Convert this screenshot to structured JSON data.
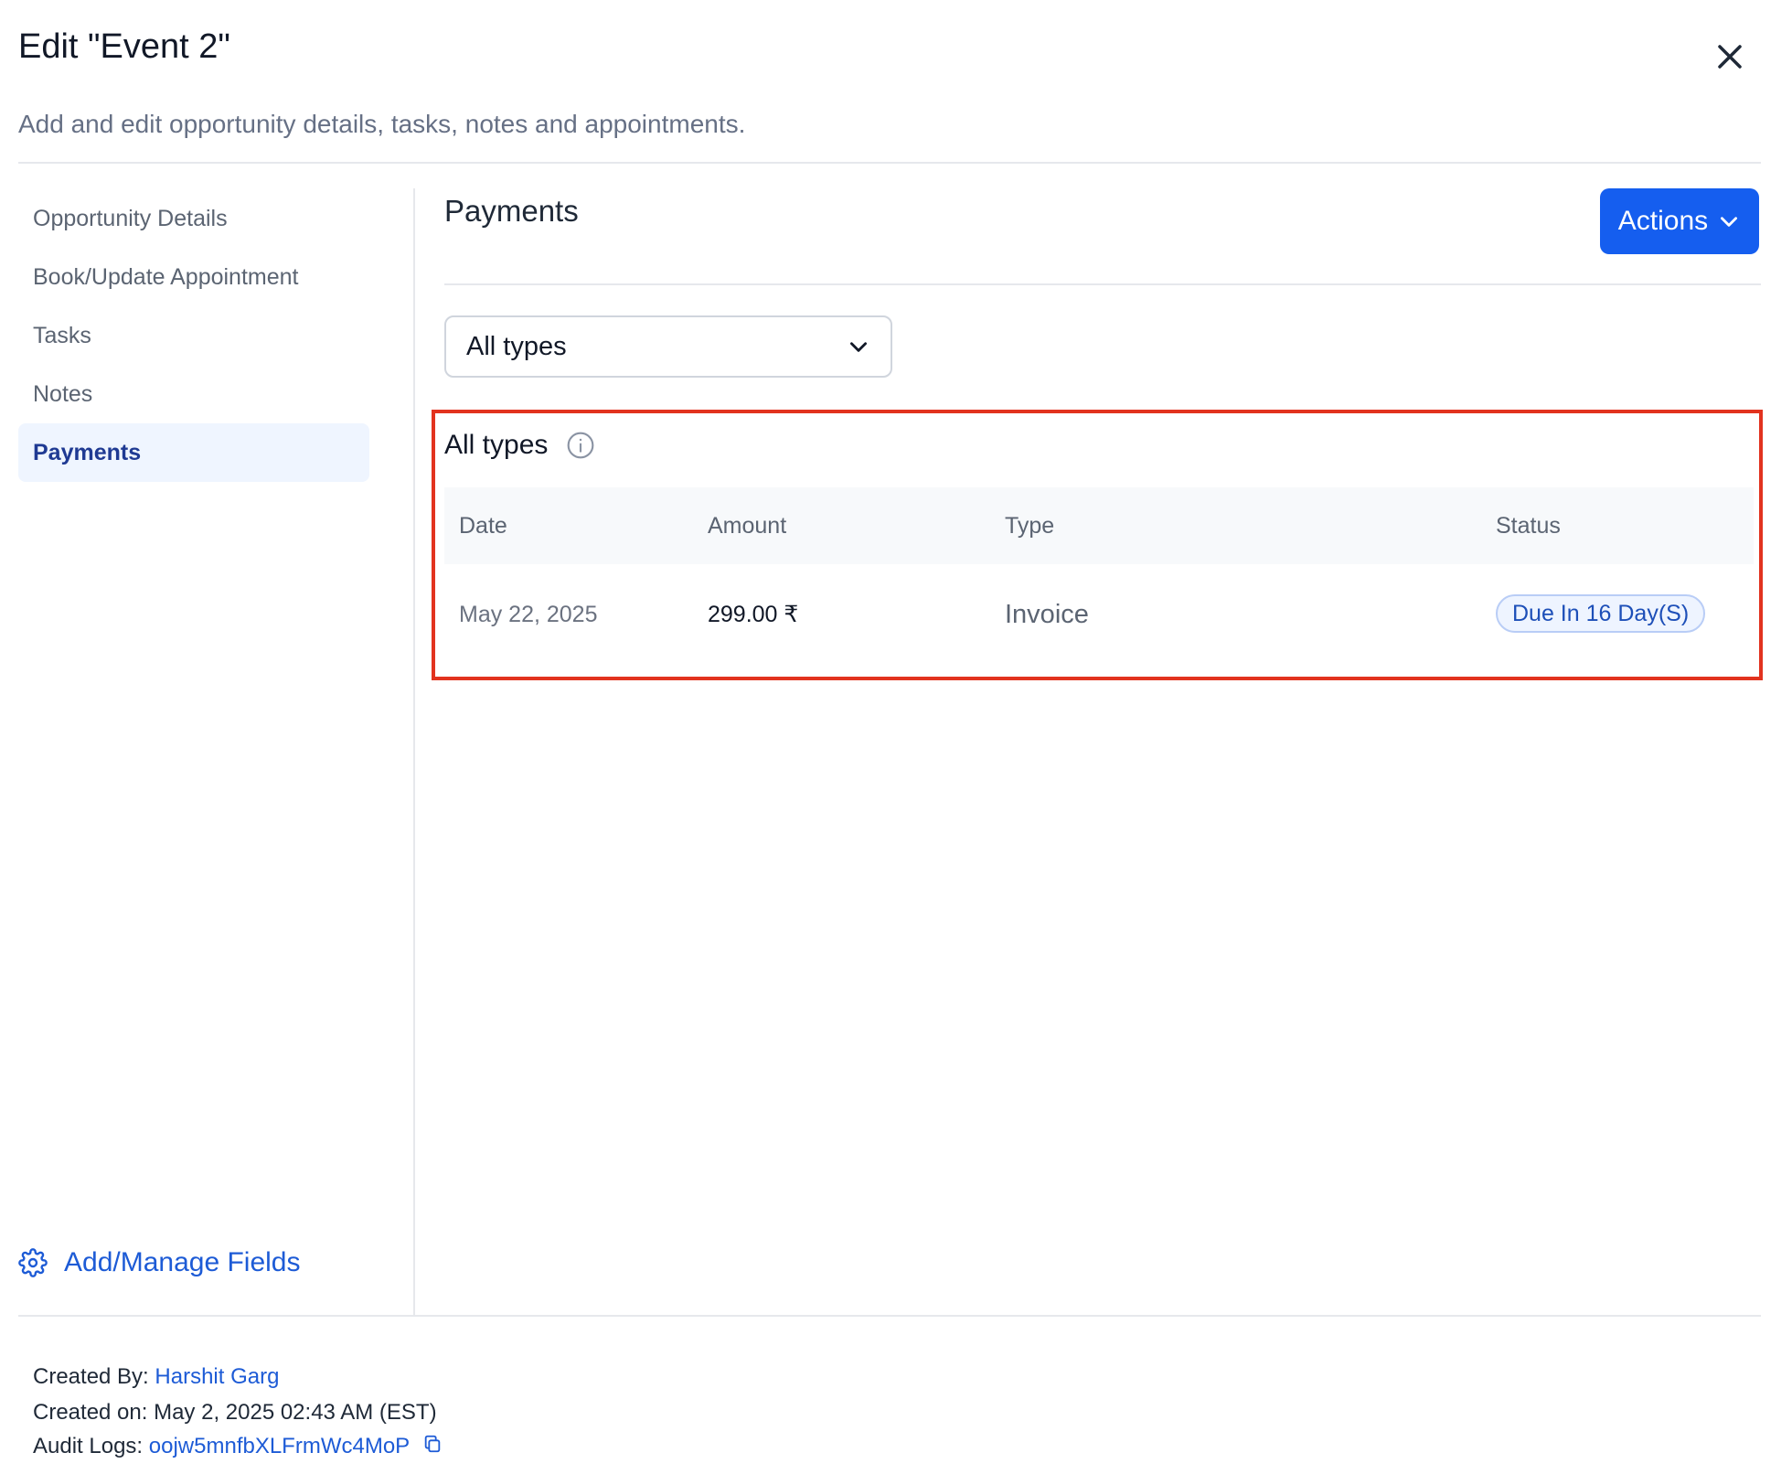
{
  "dialog": {
    "title": "Edit \"Event 2\"",
    "subtitle": "Add and edit opportunity details, tasks, notes and appointments."
  },
  "sidebar": {
    "items": [
      {
        "label": "Opportunity Details"
      },
      {
        "label": "Book/Update Appointment"
      },
      {
        "label": "Tasks"
      },
      {
        "label": "Notes"
      },
      {
        "label": "Payments",
        "active": true
      }
    ],
    "manage_fields": "Add/Manage Fields"
  },
  "main": {
    "title": "Payments",
    "actions_label": "Actions",
    "filter": {
      "selected": "All types"
    },
    "card": {
      "title": "All types",
      "columns": [
        "Date",
        "Amount",
        "Type",
        "Status"
      ],
      "rows": [
        {
          "date": "May 22, 2025",
          "amount": "299.00 ₹",
          "type": "Invoice",
          "status": "Due In 16 Day(S)"
        }
      ]
    }
  },
  "footer": {
    "created_by_label": "Created By:",
    "created_by": "Harshit Garg",
    "created_on": "Created on: May 2, 2025 02:43 AM (EST)",
    "audit_logs_label": "Audit Logs:",
    "audit_logs_id": "oojw5mnfbXLFrmWc4MoP"
  },
  "colors": {
    "accent": "#155eef",
    "highlight": "#e2331f",
    "active_nav_bg": "#eff5ff",
    "badge_bg": "#eef4ff"
  },
  "icons": {
    "close": "close-icon",
    "dropdown": "chevron-down-icon",
    "info": "info-icon",
    "settings": "gear-icon",
    "copy": "copy-icon"
  }
}
